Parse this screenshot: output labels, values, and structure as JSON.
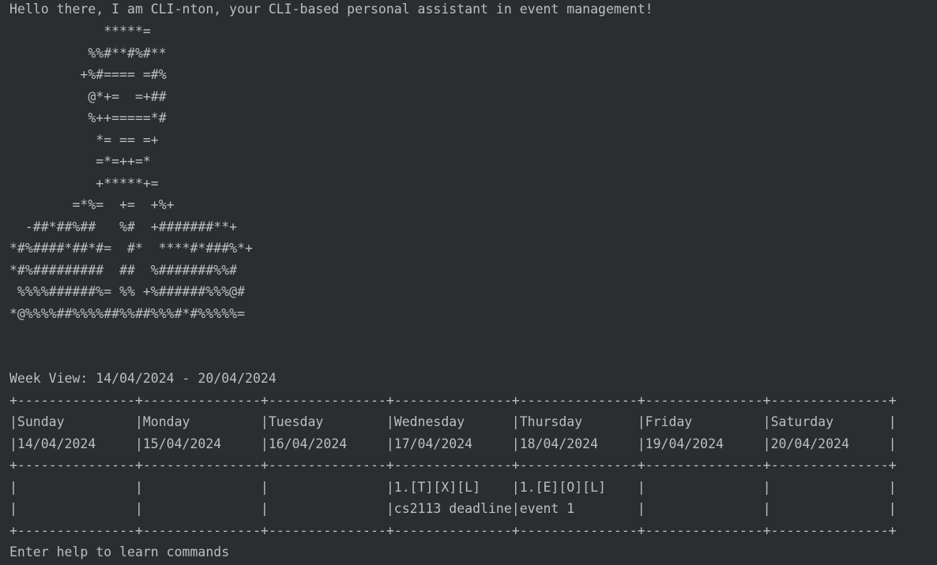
{
  "greeting": "Hello there, I am CLI-nton, your CLI-based personal assistant in event management!",
  "ascii_art": [
    "            *****=",
    "          %%#**#%#**",
    "         +%#==== =#%",
    "          @*+=  =+##",
    "          %++=====*#",
    "           *= == =+",
    "           =*=++=*",
    "           +*****+=",
    "        =*%=  +=  +%+",
    "  -##*##%##   %#  +#######**+",
    "*#%####*##*#=  #*  ****#*###%*+",
    "*#%#########  ##  %#######%%#",
    " %%%%######%= %% +%######%%%@#",
    "*@%%%%##%%%%##%%##%%%#*#%%%%%="
  ],
  "week_view": {
    "title": "Week View: 14/04/2024 - 20/04/2024",
    "border": "+---------------+---------------+---------------+---------------+---------------+---------------+---------------+",
    "day_names_row": "|Sunday         |Monday         |Tuesday        |Wednesday      |Thursday       |Friday         |Saturday       |",
    "dates_row": "|14/04/2024     |15/04/2024     |16/04/2024     |17/04/2024     |18/04/2024     |19/04/2024     |20/04/2024     |",
    "event_row_1": "|               |               |               |1.[T][X][L]    |1.[E][O][L]    |               |               |",
    "event_row_2": "|               |               |               |cs2113 deadline|event 1        |               |               |"
  },
  "prompt": "Enter help to learn commands"
}
